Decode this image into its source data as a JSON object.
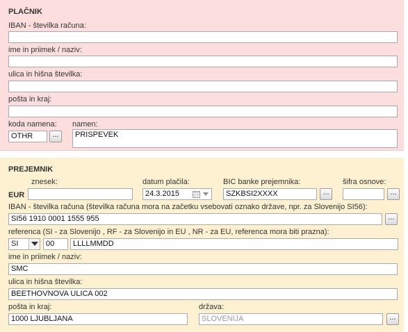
{
  "payer": {
    "title": "PLAČNIK",
    "iban_label": "IBAN - številka računa:",
    "iban_value": "",
    "name_label": "ime in priimek / naziv:",
    "name_value": "",
    "street_label": "ulica in hišna številka:",
    "street_value": "",
    "post_label": "pošta in kraj:",
    "post_value": "",
    "purpose_code_label": "koda namena:",
    "purpose_code_value": "OTHR",
    "purpose_label": "namen:",
    "purpose_value": "PRISPEVEK",
    "browse_label": "..."
  },
  "payee": {
    "title": "PREJEMNIK",
    "amount_label": "znesek:",
    "currency": "EUR",
    "amount_value": "",
    "date_label": "datum plačila:",
    "date_value": "24.3.2015",
    "bic_label": "BIC banke prejemnika:",
    "bic_value": "SZKBSI2XXXX",
    "basis_label": "šifra osnove:",
    "basis_value": "",
    "iban_label": "IBAN - številka računa (številka računa mora na začetku vsebovati oznako države, npr. za Slovenijo SI56):",
    "iban_value": "SI56 1910 0001 1555 955",
    "ref_label": "referenca (SI - za Slovenijo , RF - za Slovenijo in EU , NR - za EU, referenca mora biti prazna):",
    "ref_prefix": "SI",
    "ref_model": "00",
    "ref_value": "LLLLMMDD",
    "name_label": "ime in priimek / naziv:",
    "name_value": "SMC",
    "street_label": "ulica in hišna številka:",
    "street_value": "BEETHOVNOVA ULICA 002",
    "post_label": "pošta in kraj:",
    "post_value": "1000 LJUBLJANA",
    "country_label": "država:",
    "country_value": "SLOVENIJA",
    "browse_label": "..."
  }
}
